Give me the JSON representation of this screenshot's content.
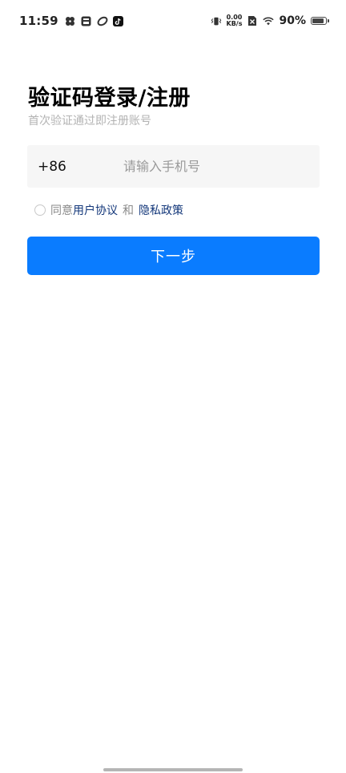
{
  "status_bar": {
    "time": "11:59",
    "net_speed_value": "0.00",
    "net_speed_unit": "KB/s",
    "battery_percent": "90%",
    "battery_level": 0.9,
    "icons": [
      "fan-icon",
      "inbox-app-icon",
      "link-app-icon",
      "tiktok-icon",
      "vibrate-icon",
      "no-sim-icon",
      "wifi-icon",
      "battery-icon"
    ]
  },
  "login": {
    "title": "验证码登录/注册",
    "subtitle": "首次验证通过即注册账号",
    "country_code": "+86",
    "phone_placeholder": "请输入手机号",
    "phone_value": ""
  },
  "agreement": {
    "prefix": "同意",
    "user_agreement": "用户协议",
    "and": "和",
    "privacy_policy": "隐私政策"
  },
  "actions": {
    "next_label": "下一步"
  },
  "colors": {
    "primary": "#0a7cff",
    "link": "#13377a",
    "input_bg": "#f6f6f6",
    "subtitle": "#b3b3b3"
  }
}
